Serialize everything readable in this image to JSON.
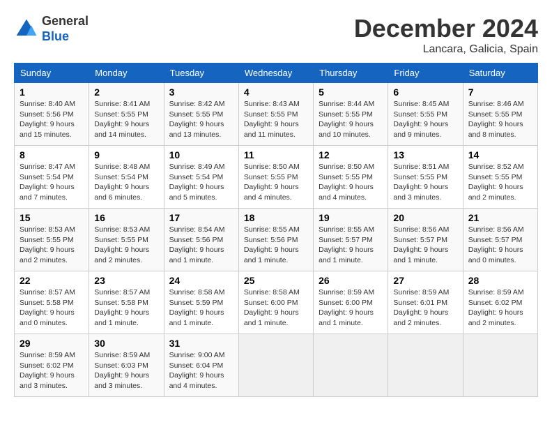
{
  "header": {
    "logo_line1": "General",
    "logo_line2": "Blue",
    "month_year": "December 2024",
    "location": "Lancara, Galicia, Spain"
  },
  "weekdays": [
    "Sunday",
    "Monday",
    "Tuesday",
    "Wednesday",
    "Thursday",
    "Friday",
    "Saturday"
  ],
  "weeks": [
    [
      {
        "day": "1",
        "sunrise": "Sunrise: 8:40 AM",
        "sunset": "Sunset: 5:56 PM",
        "daylight": "Daylight: 9 hours and 15 minutes."
      },
      {
        "day": "2",
        "sunrise": "Sunrise: 8:41 AM",
        "sunset": "Sunset: 5:55 PM",
        "daylight": "Daylight: 9 hours and 14 minutes."
      },
      {
        "day": "3",
        "sunrise": "Sunrise: 8:42 AM",
        "sunset": "Sunset: 5:55 PM",
        "daylight": "Daylight: 9 hours and 13 minutes."
      },
      {
        "day": "4",
        "sunrise": "Sunrise: 8:43 AM",
        "sunset": "Sunset: 5:55 PM",
        "daylight": "Daylight: 9 hours and 11 minutes."
      },
      {
        "day": "5",
        "sunrise": "Sunrise: 8:44 AM",
        "sunset": "Sunset: 5:55 PM",
        "daylight": "Daylight: 9 hours and 10 minutes."
      },
      {
        "day": "6",
        "sunrise": "Sunrise: 8:45 AM",
        "sunset": "Sunset: 5:55 PM",
        "daylight": "Daylight: 9 hours and 9 minutes."
      },
      {
        "day": "7",
        "sunrise": "Sunrise: 8:46 AM",
        "sunset": "Sunset: 5:55 PM",
        "daylight": "Daylight: 9 hours and 8 minutes."
      }
    ],
    [
      {
        "day": "8",
        "sunrise": "Sunrise: 8:47 AM",
        "sunset": "Sunset: 5:54 PM",
        "daylight": "Daylight: 9 hours and 7 minutes."
      },
      {
        "day": "9",
        "sunrise": "Sunrise: 8:48 AM",
        "sunset": "Sunset: 5:54 PM",
        "daylight": "Daylight: 9 hours and 6 minutes."
      },
      {
        "day": "10",
        "sunrise": "Sunrise: 8:49 AM",
        "sunset": "Sunset: 5:54 PM",
        "daylight": "Daylight: 9 hours and 5 minutes."
      },
      {
        "day": "11",
        "sunrise": "Sunrise: 8:50 AM",
        "sunset": "Sunset: 5:55 PM",
        "daylight": "Daylight: 9 hours and 4 minutes."
      },
      {
        "day": "12",
        "sunrise": "Sunrise: 8:50 AM",
        "sunset": "Sunset: 5:55 PM",
        "daylight": "Daylight: 9 hours and 4 minutes."
      },
      {
        "day": "13",
        "sunrise": "Sunrise: 8:51 AM",
        "sunset": "Sunset: 5:55 PM",
        "daylight": "Daylight: 9 hours and 3 minutes."
      },
      {
        "day": "14",
        "sunrise": "Sunrise: 8:52 AM",
        "sunset": "Sunset: 5:55 PM",
        "daylight": "Daylight: 9 hours and 2 minutes."
      }
    ],
    [
      {
        "day": "15",
        "sunrise": "Sunrise: 8:53 AM",
        "sunset": "Sunset: 5:55 PM",
        "daylight": "Daylight: 9 hours and 2 minutes."
      },
      {
        "day": "16",
        "sunrise": "Sunrise: 8:53 AM",
        "sunset": "Sunset: 5:55 PM",
        "daylight": "Daylight: 9 hours and 2 minutes."
      },
      {
        "day": "17",
        "sunrise": "Sunrise: 8:54 AM",
        "sunset": "Sunset: 5:56 PM",
        "daylight": "Daylight: 9 hours and 1 minute."
      },
      {
        "day": "18",
        "sunrise": "Sunrise: 8:55 AM",
        "sunset": "Sunset: 5:56 PM",
        "daylight": "Daylight: 9 hours and 1 minute."
      },
      {
        "day": "19",
        "sunrise": "Sunrise: 8:55 AM",
        "sunset": "Sunset: 5:57 PM",
        "daylight": "Daylight: 9 hours and 1 minute."
      },
      {
        "day": "20",
        "sunrise": "Sunrise: 8:56 AM",
        "sunset": "Sunset: 5:57 PM",
        "daylight": "Daylight: 9 hours and 1 minute."
      },
      {
        "day": "21",
        "sunrise": "Sunrise: 8:56 AM",
        "sunset": "Sunset: 5:57 PM",
        "daylight": "Daylight: 9 hours and 0 minutes."
      }
    ],
    [
      {
        "day": "22",
        "sunrise": "Sunrise: 8:57 AM",
        "sunset": "Sunset: 5:58 PM",
        "daylight": "Daylight: 9 hours and 0 minutes."
      },
      {
        "day": "23",
        "sunrise": "Sunrise: 8:57 AM",
        "sunset": "Sunset: 5:58 PM",
        "daylight": "Daylight: 9 hours and 1 minute."
      },
      {
        "day": "24",
        "sunrise": "Sunrise: 8:58 AM",
        "sunset": "Sunset: 5:59 PM",
        "daylight": "Daylight: 9 hours and 1 minute."
      },
      {
        "day": "25",
        "sunrise": "Sunrise: 8:58 AM",
        "sunset": "Sunset: 6:00 PM",
        "daylight": "Daylight: 9 hours and 1 minute."
      },
      {
        "day": "26",
        "sunrise": "Sunrise: 8:59 AM",
        "sunset": "Sunset: 6:00 PM",
        "daylight": "Daylight: 9 hours and 1 minute."
      },
      {
        "day": "27",
        "sunrise": "Sunrise: 8:59 AM",
        "sunset": "Sunset: 6:01 PM",
        "daylight": "Daylight: 9 hours and 2 minutes."
      },
      {
        "day": "28",
        "sunrise": "Sunrise: 8:59 AM",
        "sunset": "Sunset: 6:02 PM",
        "daylight": "Daylight: 9 hours and 2 minutes."
      }
    ],
    [
      {
        "day": "29",
        "sunrise": "Sunrise: 8:59 AM",
        "sunset": "Sunset: 6:02 PM",
        "daylight": "Daylight: 9 hours and 3 minutes."
      },
      {
        "day": "30",
        "sunrise": "Sunrise: 8:59 AM",
        "sunset": "Sunset: 6:03 PM",
        "daylight": "Daylight: 9 hours and 3 minutes."
      },
      {
        "day": "31",
        "sunrise": "Sunrise: 9:00 AM",
        "sunset": "Sunset: 6:04 PM",
        "daylight": "Daylight: 9 hours and 4 minutes."
      },
      null,
      null,
      null,
      null
    ]
  ]
}
